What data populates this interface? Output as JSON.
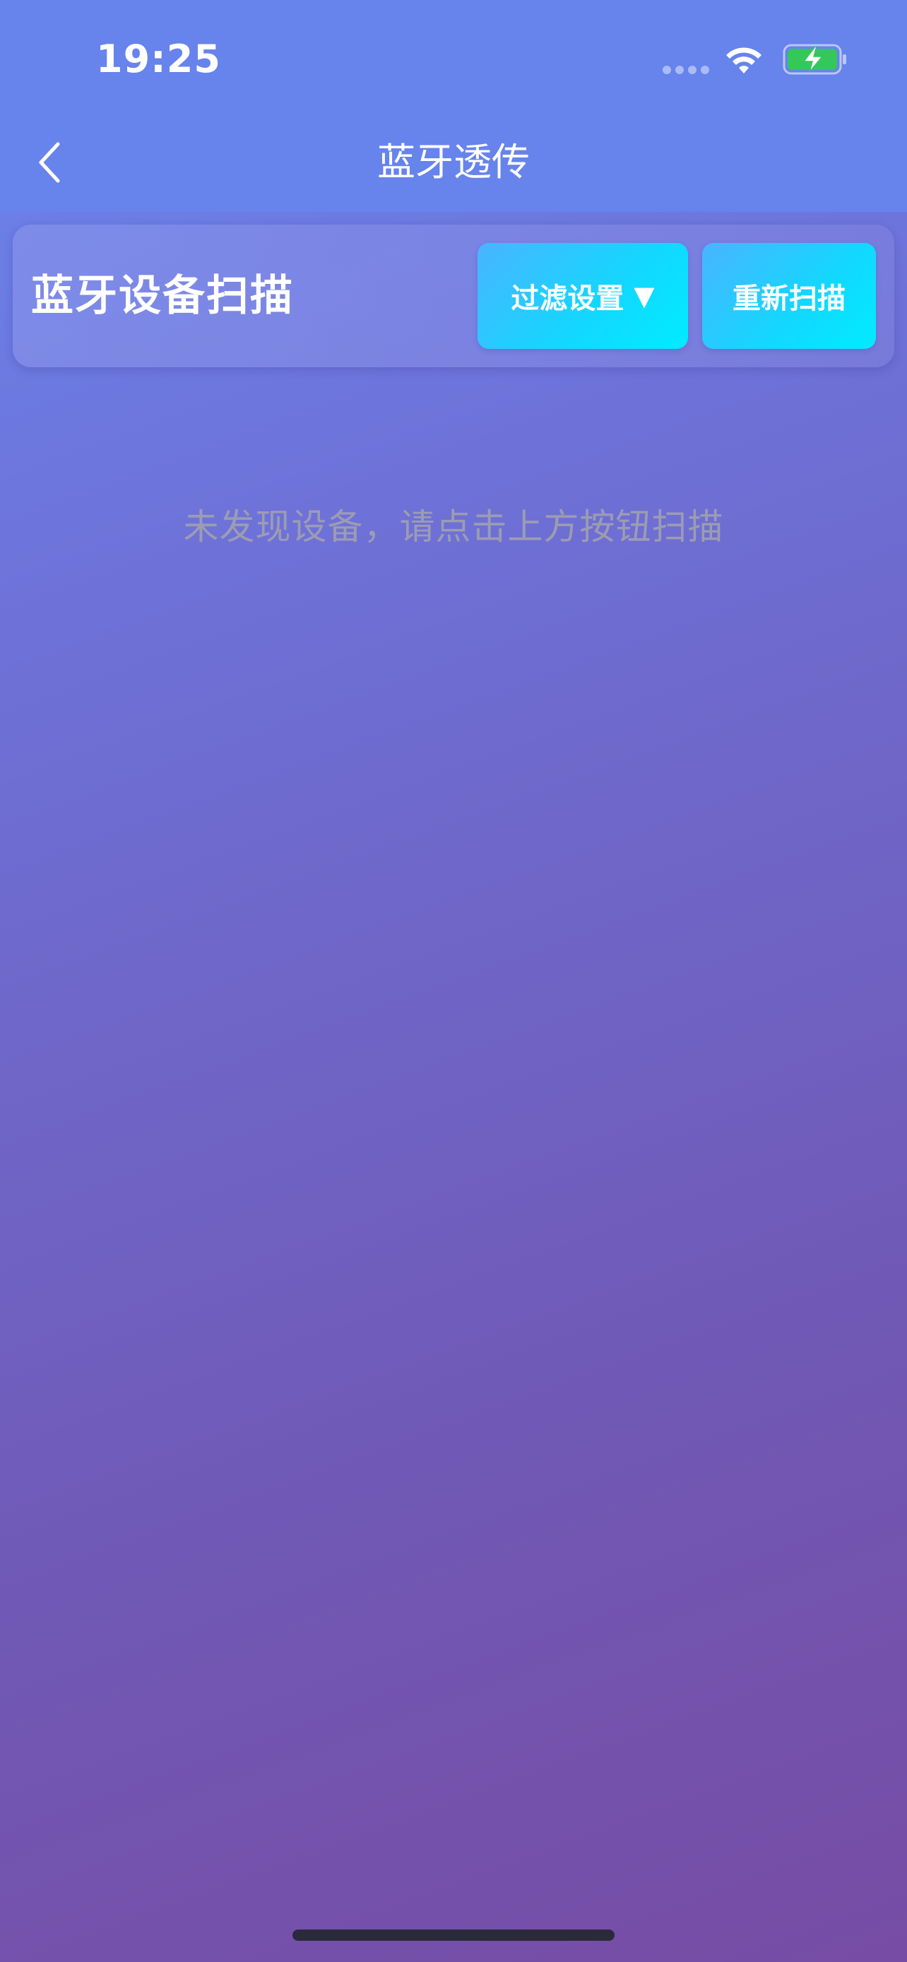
{
  "status_bar": {
    "time": "19:25",
    "icons": [
      "signal-icon",
      "wifi-icon",
      "battery-charging-icon"
    ]
  },
  "nav": {
    "title": "蓝牙透传",
    "back_icon": "chevron-left-icon"
  },
  "scan_card": {
    "title": "蓝牙设备扫描",
    "filter_button": {
      "label": "过滤设置",
      "caret": "▼"
    },
    "rescan_button": {
      "label": "重新扫描"
    }
  },
  "empty_state": {
    "message": "未发现设备，请点击上方按钮扫描"
  },
  "colors": {
    "nav_background": "#6783ec",
    "button_gradient_start": "#4ab4ff",
    "button_gradient_end": "#00ecff",
    "battery_fill": "#34c759",
    "empty_text": "#9c9cb2"
  }
}
